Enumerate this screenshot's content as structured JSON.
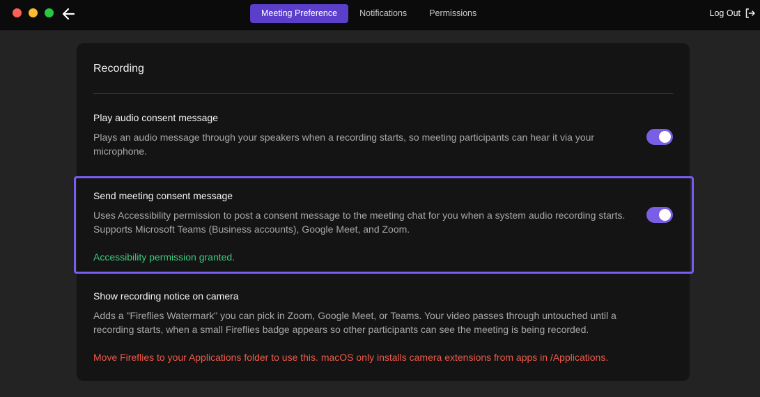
{
  "header": {
    "tabs": [
      {
        "label": "Meeting Preference",
        "active": true
      },
      {
        "label": "Notifications",
        "active": false
      },
      {
        "label": "Permissions",
        "active": false
      }
    ],
    "logout_label": "Log Out",
    "back_icon": "arrow-left-icon",
    "logout_icon": "logout-icon"
  },
  "recording": {
    "title": "Recording",
    "settings": [
      {
        "title": "Play audio consent message",
        "description": "Plays an audio message through your speakers when a recording starts, so meeting participants can hear it via your microphone.",
        "enabled": true
      },
      {
        "title": "Send meeting consent message",
        "description": "Uses Accessibility permission to post a consent message to the meeting chat for you when a system audio recording starts. Supports Microsoft Teams (Business accounts), Google Meet, and Zoom.",
        "status": "Accessibility permission granted.",
        "enabled": true
      },
      {
        "title": "Show recording notice on camera",
        "description": "Adds a \"Fireflies Watermark\" you can pick in Zoom, Google Meet, or Teams. Your video passes through untouched until a recording starts, when a small Fireflies badge appears so other participants can see the meeting is being recorded.",
        "warning": "Move Fireflies to your Applications folder to use this. macOS only installs camera extensions from apps in /Applications."
      }
    ]
  },
  "colors": {
    "accent": "#5b3fcb",
    "toggle_on": "#7a5fe6",
    "success": "#3ccb7f",
    "warning": "#ef5a4a"
  }
}
